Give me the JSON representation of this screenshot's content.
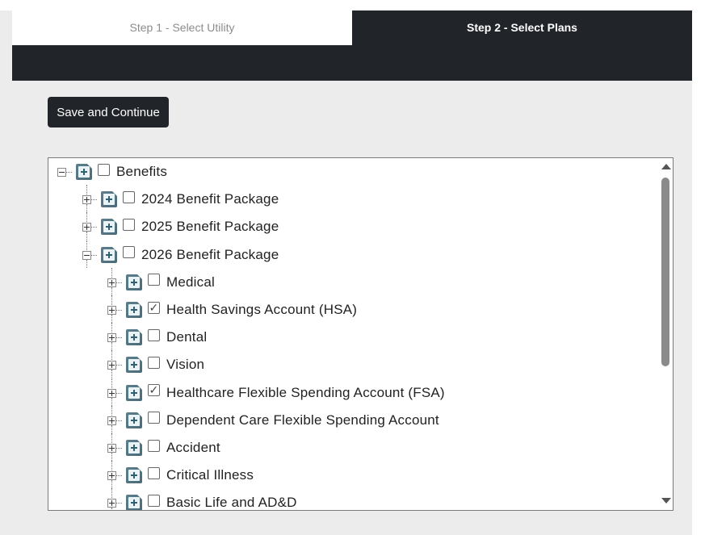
{
  "tabs": [
    {
      "label": "Step 1 - Select Utility",
      "active": false
    },
    {
      "label": "Step 2 - Select Plans",
      "active": true
    }
  ],
  "toolbar": {
    "save_label": "Save and Continue"
  },
  "tree": [
    {
      "label": "Benefits",
      "level": 0,
      "expanded": true,
      "checked": false
    },
    {
      "label": "2024 Benefit Package",
      "level": 1,
      "expanded": false,
      "checked": false
    },
    {
      "label": "2025 Benefit Package",
      "level": 1,
      "expanded": false,
      "checked": false
    },
    {
      "label": "2026 Benefit Package",
      "level": 1,
      "expanded": true,
      "checked": false
    },
    {
      "label": "Medical",
      "level": 2,
      "expanded": false,
      "checked": false
    },
    {
      "label": "Health Savings Account (HSA)",
      "level": 2,
      "expanded": false,
      "checked": true
    },
    {
      "label": "Dental",
      "level": 2,
      "expanded": false,
      "checked": false
    },
    {
      "label": "Vision",
      "level": 2,
      "expanded": false,
      "checked": false
    },
    {
      "label": "Healthcare Flexible Spending Account (FSA)",
      "level": 2,
      "expanded": false,
      "checked": true
    },
    {
      "label": "Dependent Care Flexible Spending Account",
      "level": 2,
      "expanded": false,
      "checked": false
    },
    {
      "label": "Accident",
      "level": 2,
      "expanded": false,
      "checked": false
    },
    {
      "label": "Critical Illness",
      "level": 2,
      "expanded": false,
      "checked": false
    },
    {
      "label": "Basic Life and AD&D",
      "level": 2,
      "expanded": false,
      "checked": false
    }
  ],
  "icons": {
    "expander_collapsed": "plus-box-icon",
    "expander_expanded": "minus-box-icon",
    "node": "folder-plus-icon",
    "check_mark": "✓"
  },
  "colors": {
    "dark": "#212529",
    "background": "#ececec",
    "icon_teal": "#4a6a78"
  }
}
